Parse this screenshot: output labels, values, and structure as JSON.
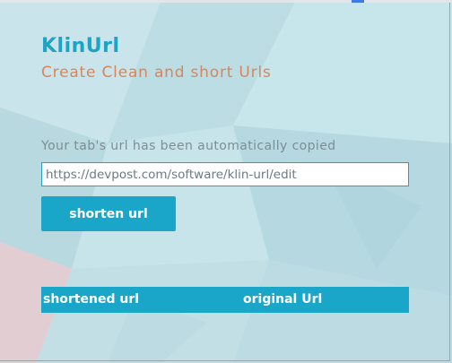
{
  "app": {
    "title": "KlinUrl",
    "subtitle": "Create Clean and short Urls"
  },
  "form": {
    "copied_message": "Your tab's url has been automatically copied",
    "url_value": "https://devpost.com/software/klin-url/edit",
    "shorten_label": "shorten url"
  },
  "table": {
    "columns": [
      "shortened url",
      "original Url"
    ]
  },
  "colors": {
    "accent": "#1aa6c9",
    "subtitle": "#d9855a",
    "background": "#bfe0e7"
  }
}
